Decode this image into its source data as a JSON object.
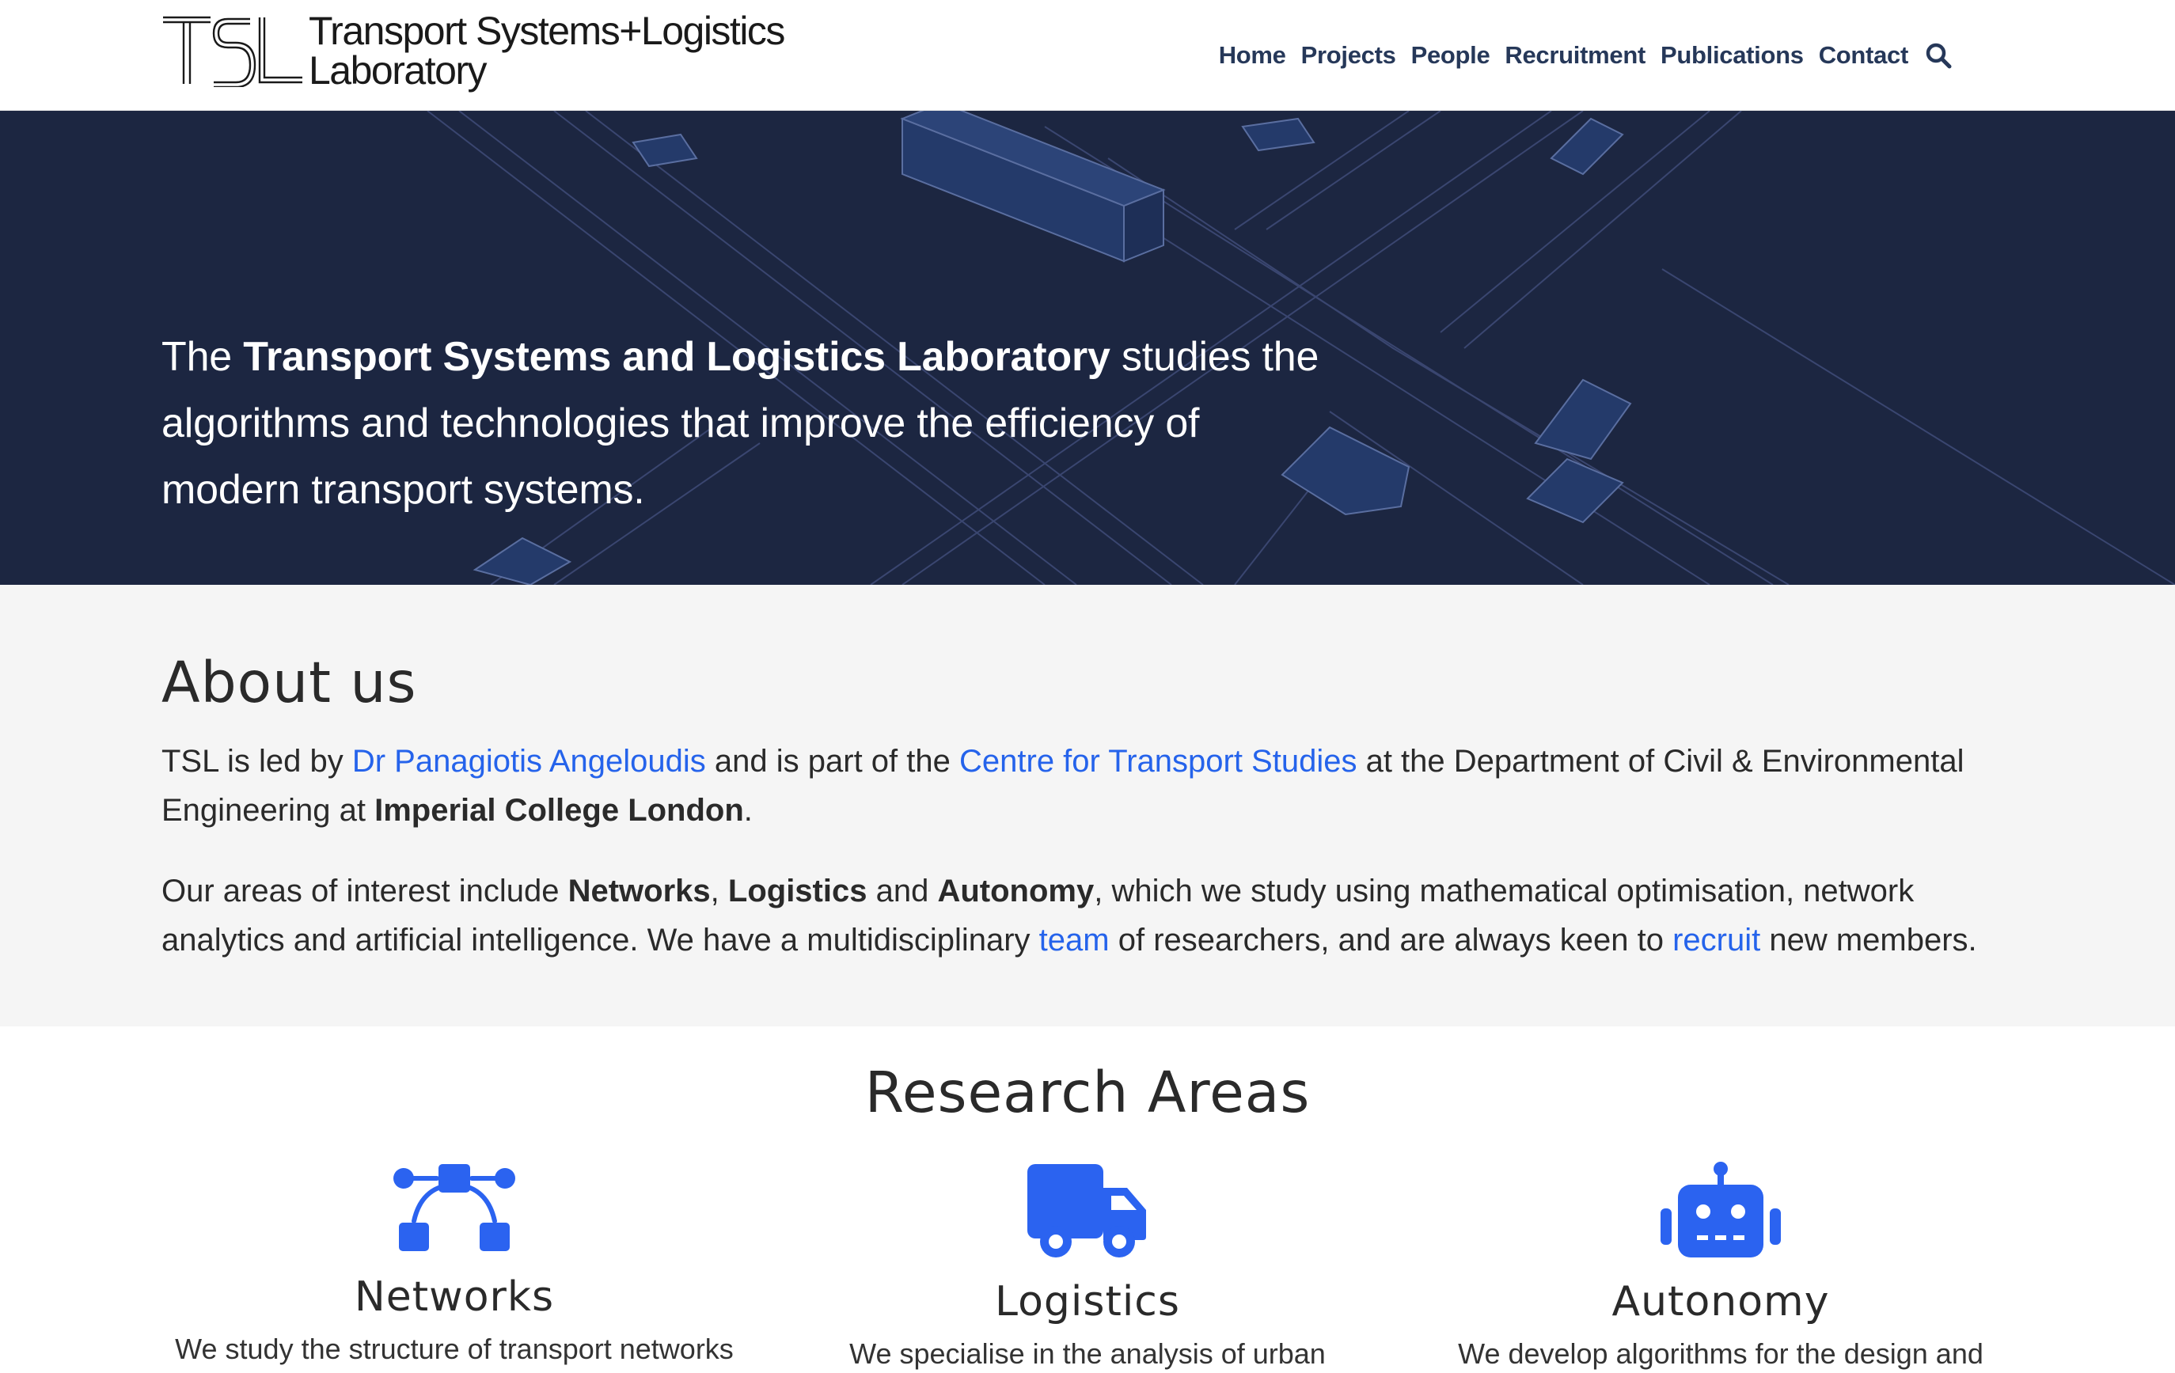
{
  "header": {
    "logo_mark": "TSL",
    "logo_line1": "Transport Systems+Logistics",
    "logo_line2": "Laboratory",
    "nav": [
      {
        "label": "Home"
      },
      {
        "label": "Projects"
      },
      {
        "label": "People"
      },
      {
        "label": "Recruitment"
      },
      {
        "label": "Publications"
      },
      {
        "label": "Contact"
      }
    ],
    "search_icon": "search-icon"
  },
  "hero": {
    "prefix": "The ",
    "bold": "Transport Systems and Logistics Laboratory",
    "suffix": " studies the algorithms and technologies that improve the efficiency of modern transport systems."
  },
  "about": {
    "title": "About us",
    "p1": {
      "t1": "TSL is led by ",
      "link1": "Dr Panagiotis Angeloudis",
      "t2": " and is part of the ",
      "link2": "Centre for Transport Studies",
      "t3": " at the Department of Civil & Environmental Engineering at ",
      "bold": "Imperial College London",
      "t4": "."
    },
    "p2": {
      "t1": "Our areas of interest include ",
      "b1": "Networks",
      "t2": ", ",
      "b2": "Logistics",
      "t3": " and ",
      "b3": "Autonomy",
      "t4": ", which we study using mathematical optimisation, network analytics and artificial intelligence. We have a multidisciplinary ",
      "link1": "team",
      "t5": " of researchers, and are always keen to ",
      "link2": "recruit",
      "t6": " new members."
    }
  },
  "research": {
    "title": "Research Areas",
    "areas": [
      {
        "title": "Networks",
        "icon": "network-icon",
        "desc": "We study the structure of transport networks"
      },
      {
        "title": "Logistics",
        "icon": "truck-icon",
        "desc": "We specialise in the analysis of urban"
      },
      {
        "title": "Autonomy",
        "icon": "robot-icon",
        "desc": "We develop algorithms for the design and"
      }
    ]
  },
  "colors": {
    "accent": "#2563eb",
    "nav": "#263859",
    "hero_bg": "#1c2641",
    "icon_blue": "#2b63f0"
  }
}
